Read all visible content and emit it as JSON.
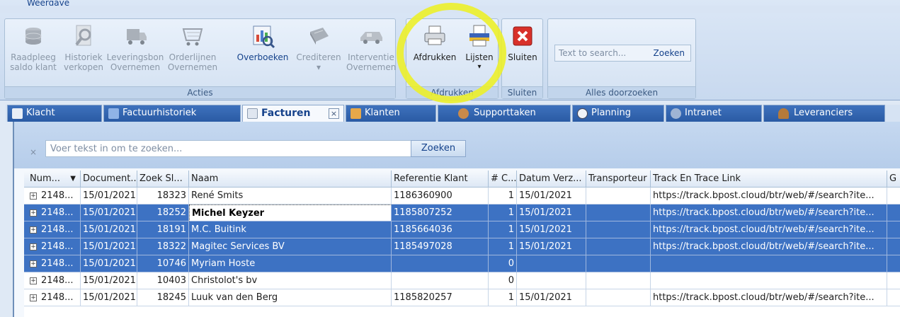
{
  "ribbon": {
    "tab_label": "Weergave",
    "groups": [
      {
        "label": "Acties",
        "buttons": [
          {
            "label1": "Raadpleeg",
            "label2": "saldo klant",
            "icon": "coins-icon",
            "enabled": false
          },
          {
            "label1": "Historiek",
            "label2": "verkopen",
            "icon": "magnifier-icon",
            "enabled": false
          },
          {
            "label1": "Leveringsbon",
            "label2": "Overnemen",
            "icon": "truck-icon",
            "enabled": false
          },
          {
            "label1": "Orderlijnen",
            "label2": "Overnemen",
            "icon": "shopping-cart-icon",
            "enabled": false
          },
          {
            "label1": "Overboeken",
            "label2": "",
            "icon": "chart-transfer-icon",
            "enabled": true
          },
          {
            "label1": "Crediteren",
            "label2": "",
            "icon": "credit-book-icon",
            "enabled": false
          },
          {
            "label1": "Interventie",
            "label2": "Overnemen",
            "icon": "van-icon",
            "enabled": false
          }
        ]
      },
      {
        "label": "Afdrukken",
        "buttons": [
          {
            "label1": "Afdrukken",
            "icon": "printer-icon",
            "enabled": true
          },
          {
            "label1": "Lijsten",
            "icon": "printer-list-icon",
            "enabled": true
          }
        ]
      },
      {
        "label": "Sluiten",
        "buttons": [
          {
            "label1": "Sluiten",
            "icon": "close-red-icon",
            "enabled": true
          }
        ]
      },
      {
        "label": "Alles doorzoeken",
        "search_placeholder": "Text to search...",
        "search_button": "Zoeken"
      }
    ]
  },
  "tabs": [
    {
      "label": "Klacht",
      "icon": "complaint-icon"
    },
    {
      "label": "Factuurhistoriek",
      "icon": "history-icon"
    },
    {
      "label": "Facturen",
      "icon": "invoice-icon",
      "active": true
    },
    {
      "label": "Klanten",
      "icon": "customers-icon"
    },
    {
      "label": "Supporttaken",
      "icon": "support-icon"
    },
    {
      "label": "Planning",
      "icon": "clock-icon"
    },
    {
      "label": "Intranet",
      "icon": "sun-icon"
    },
    {
      "label": "Leveranciers",
      "icon": "supplier-icon"
    }
  ],
  "filter": {
    "clear": "×",
    "placeholder": "Voer tekst in om te zoeken...",
    "button": "Zoeken"
  },
  "grid": {
    "columns": [
      "Num...",
      "Document...",
      "Zoek Sl...",
      "Naam",
      "Referentie Klant",
      "# C...",
      "Datum Verz...",
      "Transporteur",
      "Track En Trace Link",
      "G"
    ],
    "sort_indicator": "▼",
    "rows": [
      {
        "num": "2148...",
        "doc": "15/01/2021",
        "zoek": "18323",
        "naam": "René Smits",
        "ref": "1186360900",
        "c": "1",
        "datum": "15/01/2021",
        "transp": "",
        "link": "https://track.bpost.cloud/btr/web/#/search?ite...",
        "selected": false
      },
      {
        "num": "2148...",
        "doc": "15/01/2021",
        "zoek": "18252",
        "naam": "Michel Keyzer",
        "ref": "1185807252",
        "c": "1",
        "datum": "15/01/2021",
        "transp": "",
        "link": "https://track.bpost.cloud/btr/web/#/search?ite...",
        "selected": true,
        "focused": true
      },
      {
        "num": "2148...",
        "doc": "15/01/2021",
        "zoek": "18191",
        "naam": "M.C. Buitink",
        "ref": "1185664036",
        "c": "1",
        "datum": "15/01/2021",
        "transp": "",
        "link": "https://track.bpost.cloud/btr/web/#/search?ite...",
        "selected": true
      },
      {
        "num": "2148...",
        "doc": "15/01/2021",
        "zoek": "18322",
        "naam": "Magitec Services BV",
        "ref": "1185497028",
        "c": "1",
        "datum": "15/01/2021",
        "transp": "",
        "link": "https://track.bpost.cloud/btr/web/#/search?ite...",
        "selected": true
      },
      {
        "num": "2148...",
        "doc": "15/01/2021",
        "zoek": "10746",
        "naam": "Myriam Hoste",
        "ref": "",
        "c": "0",
        "datum": "",
        "transp": "",
        "link": "",
        "selected": true
      },
      {
        "num": "2148...",
        "doc": "15/01/2021",
        "zoek": "10403",
        "naam": "Christolot's bv",
        "ref": "",
        "c": "0",
        "datum": "",
        "transp": "",
        "link": "",
        "selected": false
      },
      {
        "num": "2148...",
        "doc": "15/01/2021",
        "zoek": "18245",
        "naam": "Luuk van den Berg",
        "ref": "1185820257",
        "c": "1",
        "datum": "15/01/2021",
        "transp": "",
        "link": "https://track.bpost.cloud/btr/web/#/search?ite...",
        "selected": false
      }
    ]
  },
  "colors": {
    "selection": "#3d72c3",
    "tab_blue": "#2a5ba4",
    "highlight": "#ecf02a"
  }
}
